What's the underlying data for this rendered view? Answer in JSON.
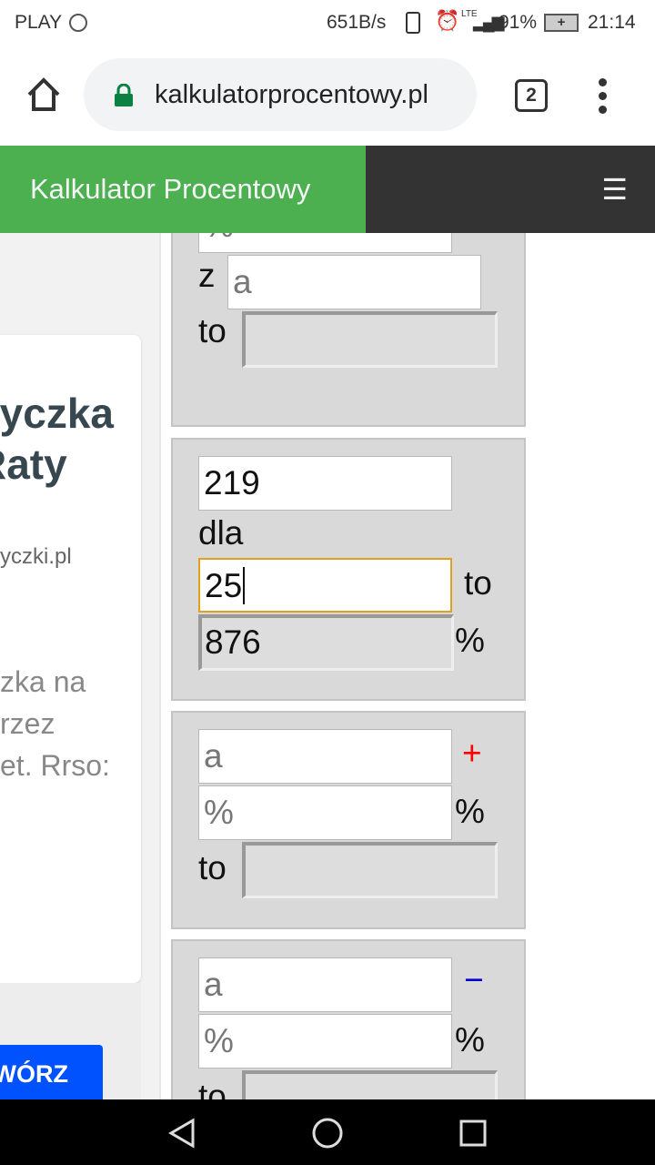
{
  "status_bar": {
    "carrier": "PLAY",
    "speed": "651B/s",
    "network": "LTE",
    "battery": "91%",
    "time": "21:14"
  },
  "browser": {
    "url": "kalkulatorprocentowy.pl",
    "tab_count": "2"
  },
  "header": {
    "title": "Kalkulator Procentowy",
    "menu_icon": "☰"
  },
  "ad": {
    "title_line1": "yczka",
    "title_line2": "Raty",
    "domain": "yczki.pl",
    "text_line1": "zka na",
    "text_line2": "rzez",
    "text_line3": "et. Rrso:",
    "button": "WÓRZ"
  },
  "calc1": {
    "percent_placeholder": "%",
    "percent_suffix": "%",
    "of_label": "z",
    "a_placeholder": "a",
    "result_label": "to"
  },
  "calc2": {
    "value1": "219",
    "for_label": "dla",
    "value2": "25",
    "to_label": "to",
    "result": "876",
    "percent_suffix": "%"
  },
  "calc3": {
    "a_placeholder": "a",
    "operator": "+",
    "percent_placeholder": "%",
    "percent_suffix": "%",
    "result_label": "to",
    "operator_color": "#ff0000"
  },
  "calc4": {
    "a_placeholder": "a",
    "operator": "−",
    "percent_placeholder": "%",
    "percent_suffix": "%",
    "result_label": "to",
    "operator_color": "#0000cc"
  },
  "colors": {
    "header_green": "#4caf50",
    "header_dark": "#333333",
    "ad_button": "#0052ff",
    "focus": "#e0a020"
  }
}
